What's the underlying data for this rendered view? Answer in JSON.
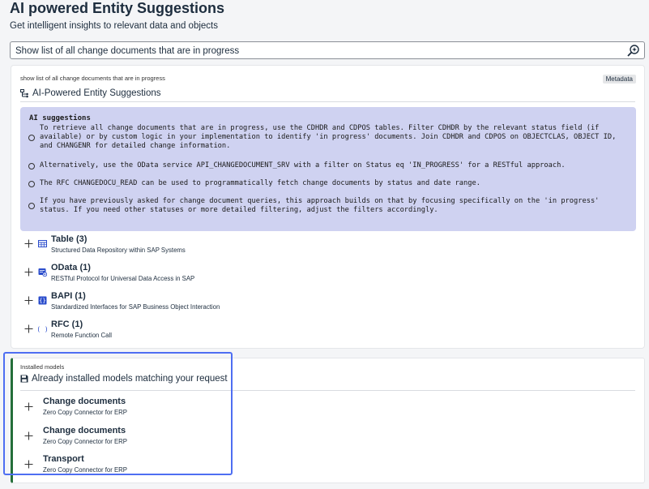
{
  "header": {
    "title": "AI powered Entity Suggestions",
    "subtitle": "Get intelligent insights to relevant data and objects"
  },
  "search": {
    "value": "Show list of all change documents that are in progress",
    "icon": "search-ai-icon"
  },
  "suggestions_panel": {
    "query_echo": "show list of all change documents that are in progress",
    "metadata_label": "Metadata",
    "heading": "AI-Powered Entity Suggestions",
    "ai_box": {
      "title": "AI suggestions",
      "items": [
        "To retrieve all change documents that are in progress, use the CDHDR and CDPOS tables. Filter CDHDR by the relevant status field (if available) or by custom logic in your implementation to identify 'in progress' documents. Join CDHDR and CDPOS on OBJECTCLAS, OBJECT ID, and CHANGENR for detailed change information.",
        "Alternatively, use the OData service API_CHANGEDOCUMENT_SRV with a filter on Status eq 'IN_PROGRESS' for a RESTful approach.",
        "The RFC CHANGEDOCU_READ can be used to programmatically fetch change documents by status and date range.",
        "If you have previously asked for change document queries, this approach builds on that by focusing specifically on the 'in progress' status. If you need other statuses or more detailed filtering, adjust the filters accordingly."
      ]
    },
    "categories": [
      {
        "title": "Table (3)",
        "description": "Structured Data Repository within SAP Systems",
        "icon": "table-icon"
      },
      {
        "title": "OData (1)",
        "description": "RESTful Protocol for Universal Data Access in SAP",
        "icon": "odata-icon"
      },
      {
        "title": "BAPI (1)",
        "description": "Standardized Interfaces for SAP Business Object Interaction",
        "icon": "bapi-icon"
      },
      {
        "title": "RFC (1)",
        "description": "Remote Function Call",
        "icon": "rfc-icon"
      }
    ]
  },
  "installed_panel": {
    "label": "Installed models",
    "heading": "Already installed models matching your request",
    "models": [
      {
        "title": "Change documents",
        "description": "Zero Copy Connector for ERP"
      },
      {
        "title": "Change documents",
        "description": "Zero Copy Connector for ERP"
      },
      {
        "title": "Transport",
        "description": "Zero Copy Connector for ERP"
      }
    ]
  },
  "colors": {
    "ai_box_bg": "#cfd2f1",
    "installed_accent": "#256f3a",
    "highlight": "#4e6ef2",
    "icon_blue": "#2b4dcc"
  }
}
